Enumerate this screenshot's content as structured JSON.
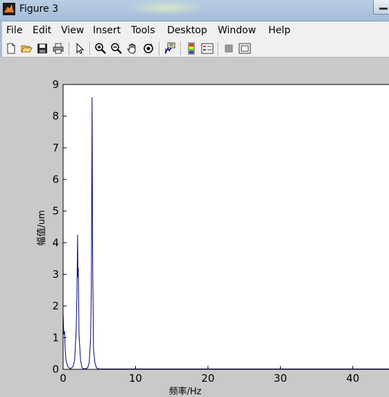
{
  "window": {
    "title": "Figure 3"
  },
  "menu": {
    "items": [
      "File",
      "Edit",
      "View",
      "Insert",
      "Tools",
      "Desktop",
      "Window",
      "Help"
    ]
  },
  "toolbar": {
    "icons": [
      "new-figure-icon",
      "open-file-icon",
      "save-icon",
      "print-icon",
      "edit-plot-arrow-icon",
      "zoom-in-icon",
      "zoom-out-icon",
      "pan-hand-icon",
      "rotate-3d-icon",
      "data-cursor-icon",
      "colorbar-icon",
      "legend-icon",
      "hide-plot-tools-icon",
      "show-plot-tools-icon"
    ]
  },
  "colors": {
    "line": "#000080",
    "background": "#c9c9c9",
    "axes_bg": "#ffffff"
  },
  "chart_data": {
    "type": "line",
    "xlabel": "频率/Hz",
    "ylabel": "幅值/um",
    "xlim": [
      0,
      45
    ],
    "ylim": [
      0,
      9
    ],
    "xticks": [
      0,
      10,
      20,
      30,
      40
    ],
    "yticks": [
      0,
      1,
      2,
      3,
      4,
      5,
      6,
      7,
      8,
      9
    ],
    "grid": false,
    "series": [
      {
        "x": [
          0,
          0.1,
          0.2,
          0.3,
          0.4,
          0.6,
          0.8,
          1.0,
          1.2,
          1.4,
          1.6,
          1.8,
          1.9,
          2.0,
          2.05,
          2.1,
          2.2,
          2.4,
          2.6,
          2.8,
          3.0,
          3.2,
          3.4,
          3.6,
          3.8,
          3.9,
          4.0,
          4.05,
          4.1,
          4.2,
          4.4,
          4.6,
          4.8,
          5.0,
          6.0,
          10,
          20,
          30,
          40,
          45
        ],
        "y": [
          1.8,
          1.1,
          1.2,
          0.6,
          0.3,
          0.1,
          0.05,
          0.02,
          0.05,
          0.1,
          0.3,
          1.2,
          2.2,
          4.25,
          2.9,
          3.2,
          1.1,
          0.3,
          0.05,
          0.02,
          0.02,
          0.02,
          0.05,
          0.2,
          1.0,
          2.5,
          8.6,
          4.6,
          3.0,
          0.6,
          0.2,
          0.05,
          0.02,
          0.01,
          0.01,
          0.01,
          0.01,
          0.01,
          0.01,
          0.01
        ]
      }
    ]
  }
}
